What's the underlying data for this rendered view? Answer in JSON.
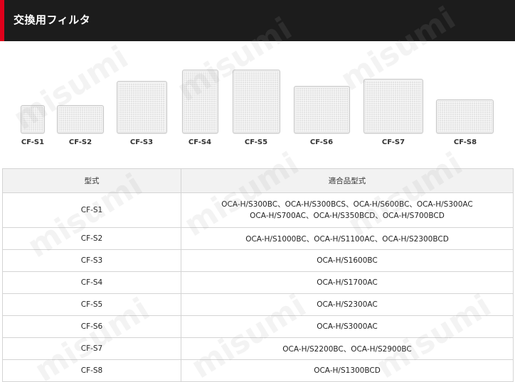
{
  "header": {
    "title": "交換用フィルタ",
    "accent_color": "#e0001b"
  },
  "watermark": "misumi",
  "filters": [
    {
      "label": "CF-S1"
    },
    {
      "label": "CF-S2"
    },
    {
      "label": "CF-S3"
    },
    {
      "label": "CF-S4"
    },
    {
      "label": "CF-S5"
    },
    {
      "label": "CF-S6"
    },
    {
      "label": "CF-S7"
    },
    {
      "label": "CF-S8"
    }
  ],
  "table": {
    "headers": {
      "model": "型式",
      "compatible": "適合品型式"
    },
    "rows": [
      {
        "model": "CF-S1",
        "compatible": [
          "OCA-H/S300BC、OCA-H/S300BCS、OCA-H/S600BC、OCA-H/S300AC",
          "OCA-H/S700AC、OCA-H/S350BCD、OCA-H/S700BCD"
        ]
      },
      {
        "model": "CF-S2",
        "compatible": [
          "OCA-H/S1000BC、OCA-H/S1100AC、OCA-H/S2300BCD"
        ]
      },
      {
        "model": "CF-S3",
        "compatible": [
          "OCA-H/S1600BC"
        ]
      },
      {
        "model": "CF-S4",
        "compatible": [
          "OCA-H/S1700AC"
        ]
      },
      {
        "model": "CF-S5",
        "compatible": [
          "OCA-H/S2300AC"
        ]
      },
      {
        "model": "CF-S6",
        "compatible": [
          "OCA-H/S3000AC"
        ]
      },
      {
        "model": "CF-S7",
        "compatible": [
          "OCA-H/S2200BC、OCA-H/S2900BC"
        ]
      },
      {
        "model": "CF-S8",
        "compatible": [
          "OCA-H/S1300BCD"
        ]
      }
    ]
  }
}
